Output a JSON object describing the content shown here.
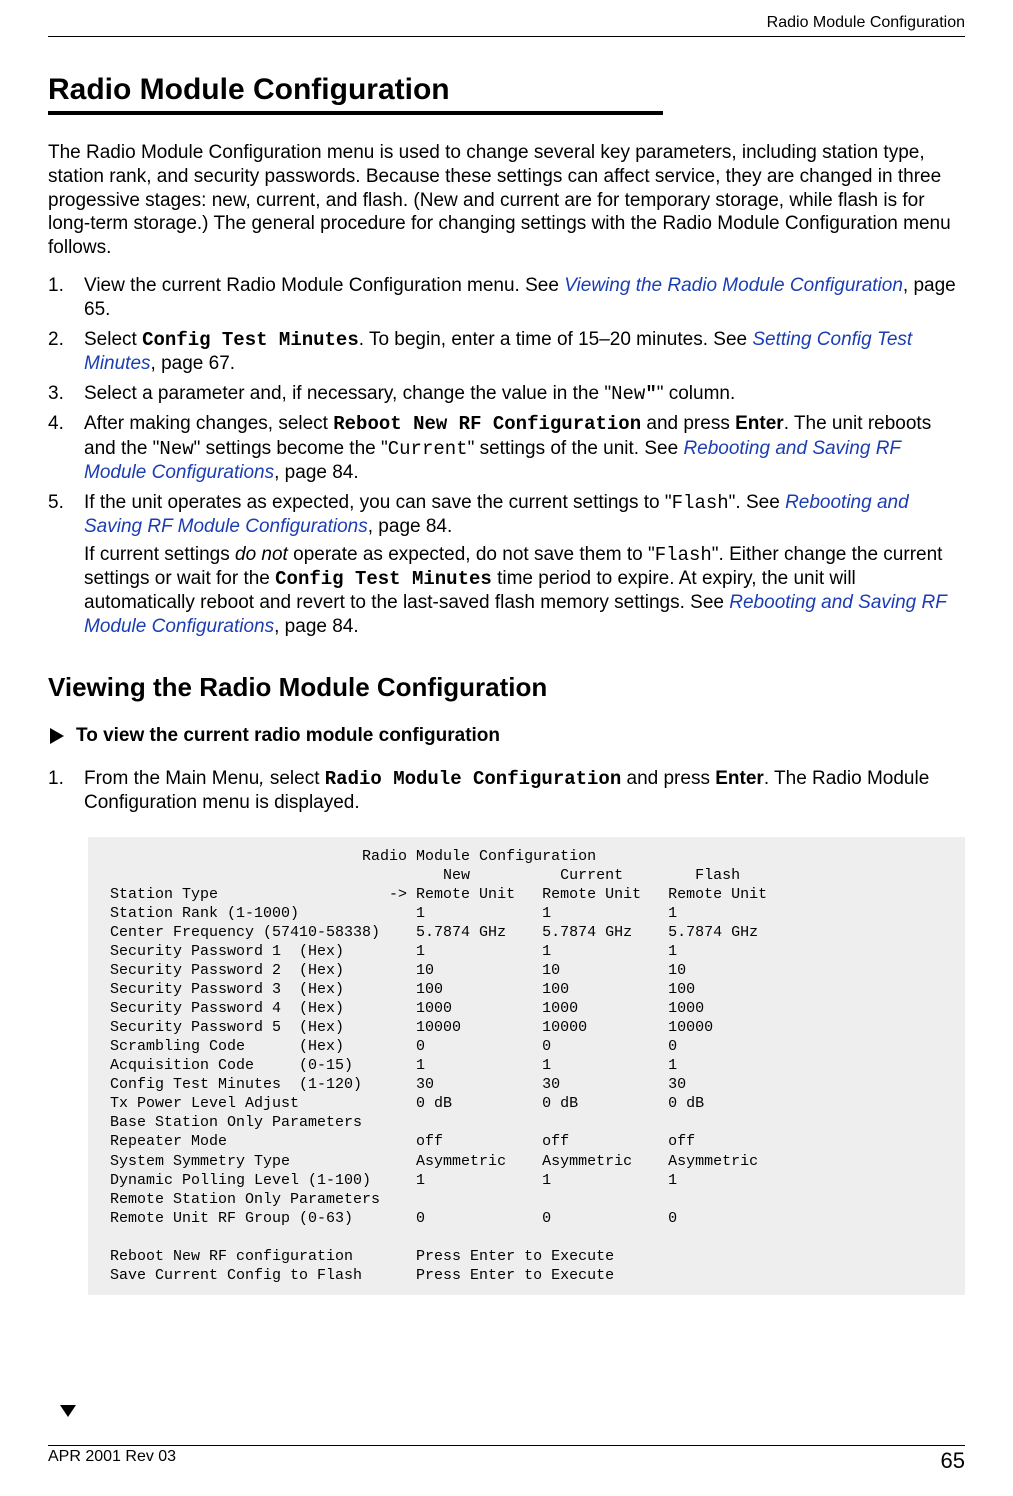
{
  "running_head": "Radio Module Configuration",
  "title": "Radio Module Configuration",
  "intro": "The Radio Module Configuration menu is used to change several key parameters, including station type, station rank, and security passwords. Because these settings can affect service, they are changed in three progessive stages: new, current, and flash. (New and current are for temporary storage, while flash is for long-term storage.) The general procedure for changing settings with the Radio Module Configuration menu follows.",
  "steps": {
    "s1_a": "View the current Radio Module Configuration menu. See ",
    "s1_link": "Viewing the Radio Module Configuration",
    "s1_b": ", page 65.",
    "s2_a": "Select ",
    "s2_mono": "Config Test Minutes",
    "s2_b": ". To begin, enter a time of 15–20 minutes. See ",
    "s2_link": "Setting Config Test Minutes",
    "s2_c": ", page 67.",
    "s3_a": "Select a parameter and, if necessary, change the value in the \"",
    "s3_mono": "New",
    "s3_b": "\" column.",
    "s4_a": "After making changes, select ",
    "s4_mono": "Reboot New RF Configuration",
    "s4_b": " and press ",
    "s4_enter": "Enter",
    "s4_c": ". The unit reboots and the \"",
    "s4_mono2": "New",
    "s4_d": "\" settings become the \"",
    "s4_mono3": "Current",
    "s4_e": "\" settings of the unit. See ",
    "s4_link": "Rebooting and Saving RF Module Configurations",
    "s4_f": ", page 84.",
    "s5_a": "If the unit operates as expected, you can save the current settings to \"",
    "s5_mono": "Flash",
    "s5_b": "\". See ",
    "s5_link": "Rebooting and Saving RF Module Configurations",
    "s5_c": ", page 84.",
    "s5p2_a": "If current settings ",
    "s5p2_em": "do not",
    "s5p2_b": " operate as expected, do not save them to \"",
    "s5p2_mono": "Flash",
    "s5p2_c": "\". Either change the current settings or wait for the ",
    "s5p2_mono2": "Config Test Minutes",
    "s5p2_d": " time period to expire. At expiry, the unit will automatically reboot and revert to the last-saved flash memory settings. See ",
    "s5p2_link": "Rebooting and Saving RF Module Configurations",
    "s5p2_e": ", page 84."
  },
  "subsection": "Viewing the Radio Module Configuration",
  "proc_title": "To view the current radio module configuration",
  "proc_steps": {
    "p1_a": "From the Main Menu",
    "p1_em": ", ",
    "p1_b": "select ",
    "p1_mono": "Radio Module Configuration",
    "p1_c": " and press ",
    "p1_enter": "Enter",
    "p1_d": ". The Radio Module Configuration menu is displayed."
  },
  "code": "                            Radio Module Configuration\n                                     New          Current        Flash\nStation Type                   -> Remote Unit   Remote Unit   Remote Unit\nStation Rank (1-1000)             1             1             1\nCenter Frequency (57410-58338)    5.7874 GHz    5.7874 GHz    5.7874 GHz\nSecurity Password 1  (Hex)        1             1             1\nSecurity Password 2  (Hex)        10            10            10\nSecurity Password 3  (Hex)        100           100           100\nSecurity Password 4  (Hex)        1000          1000          1000\nSecurity Password 5  (Hex)        10000         10000         10000\nScrambling Code      (Hex)        0             0             0\nAcquisition Code     (0-15)       1             1             1\nConfig Test Minutes  (1-120)      30            30            30\nTx Power Level Adjust             0 dB          0 dB          0 dB\nBase Station Only Parameters\nRepeater Mode                     off           off           off\nSystem Symmetry Type              Asymmetric    Asymmetric    Asymmetric\nDynamic Polling Level (1-100)     1             1             1\nRemote Station Only Parameters\nRemote Unit RF Group (0-63)       0             0             0\n\nReboot New RF configuration       Press Enter to Execute\nSave Current Config to Flash      Press Enter to Execute",
  "footer_left": "APR 2001 Rev 03",
  "footer_right": "65"
}
